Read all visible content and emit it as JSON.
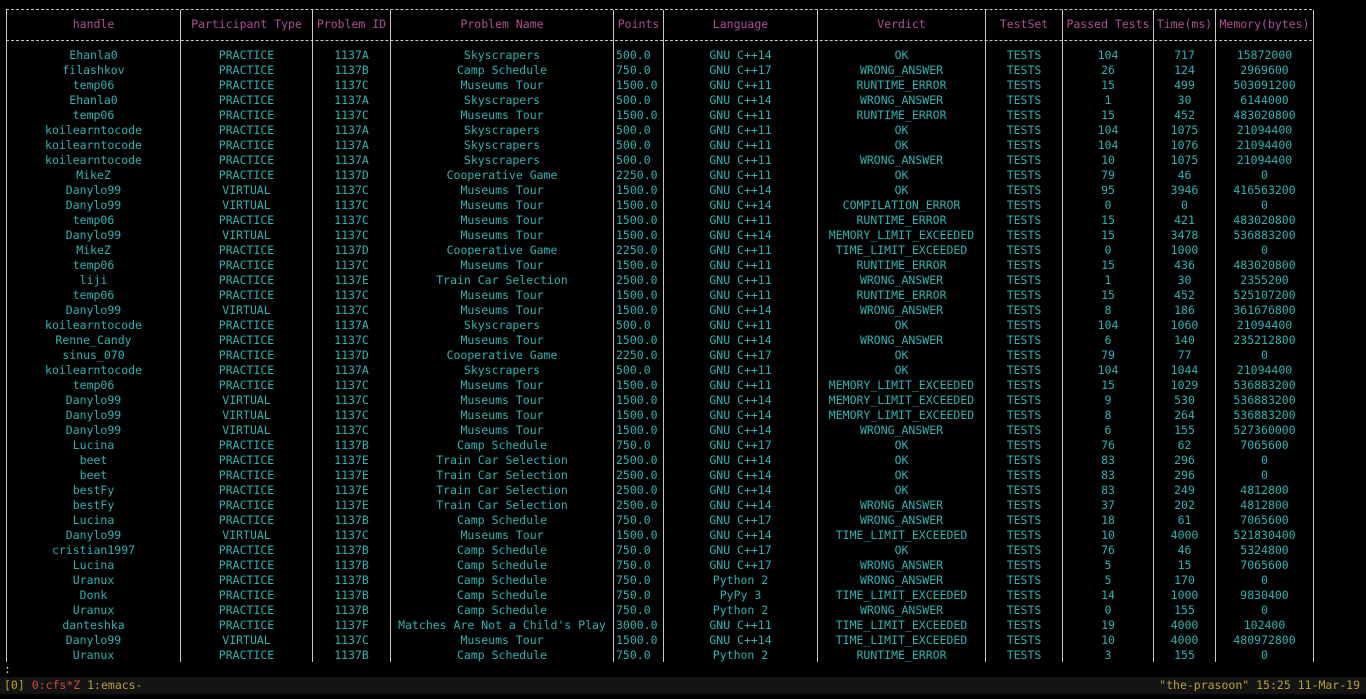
{
  "table": {
    "columns": [
      "handle",
      "Participant Type",
      "Problem ID",
      "Problem Name",
      "Points",
      "Language",
      "Verdict",
      "TestSet",
      "Passed Tests",
      "Time(ms)",
      "Memory(bytes)"
    ],
    "rows": [
      [
        "Ehanla0",
        "PRACTICE",
        "1137A",
        "Skyscrapers",
        "500.0",
        "GNU C++14",
        "OK",
        "TESTS",
        "104",
        "717",
        "15872000"
      ],
      [
        "filashkov",
        "PRACTICE",
        "1137B",
        "Camp Schedule",
        "750.0",
        "GNU C++17",
        "WRONG_ANSWER",
        "TESTS",
        "26",
        "124",
        "2969600"
      ],
      [
        "temp06",
        "PRACTICE",
        "1137C",
        "Museums Tour",
        "1500.0",
        "GNU C++11",
        "RUNTIME_ERROR",
        "TESTS",
        "15",
        "499",
        "503091200"
      ],
      [
        "Ehanla0",
        "PRACTICE",
        "1137A",
        "Skyscrapers",
        "500.0",
        "GNU C++14",
        "WRONG_ANSWER",
        "TESTS",
        "1",
        "30",
        "6144000"
      ],
      [
        "temp06",
        "PRACTICE",
        "1137C",
        "Museums Tour",
        "1500.0",
        "GNU C++11",
        "RUNTIME_ERROR",
        "TESTS",
        "15",
        "452",
        "483020800"
      ],
      [
        "koilearntocode",
        "PRACTICE",
        "1137A",
        "Skyscrapers",
        "500.0",
        "GNU C++11",
        "OK",
        "TESTS",
        "104",
        "1075",
        "21094400"
      ],
      [
        "koilearntocode",
        "PRACTICE",
        "1137A",
        "Skyscrapers",
        "500.0",
        "GNU C++11",
        "OK",
        "TESTS",
        "104",
        "1076",
        "21094400"
      ],
      [
        "koilearntocode",
        "PRACTICE",
        "1137A",
        "Skyscrapers",
        "500.0",
        "GNU C++11",
        "WRONG_ANSWER",
        "TESTS",
        "10",
        "1075",
        "21094400"
      ],
      [
        "MikeZ",
        "PRACTICE",
        "1137D",
        "Cooperative Game",
        "2250.0",
        "GNU C++11",
        "OK",
        "TESTS",
        "79",
        "46",
        "0"
      ],
      [
        "Danylo99",
        "VIRTUAL",
        "1137C",
        "Museums Tour",
        "1500.0",
        "GNU C++14",
        "OK",
        "TESTS",
        "95",
        "3946",
        "416563200"
      ],
      [
        "Danylo99",
        "VIRTUAL",
        "1137C",
        "Museums Tour",
        "1500.0",
        "GNU C++14",
        "COMPILATION_ERROR",
        "TESTS",
        "0",
        "0",
        "0"
      ],
      [
        "temp06",
        "PRACTICE",
        "1137C",
        "Museums Tour",
        "1500.0",
        "GNU C++11",
        "RUNTIME_ERROR",
        "TESTS",
        "15",
        "421",
        "483020800"
      ],
      [
        "Danylo99",
        "VIRTUAL",
        "1137C",
        "Museums Tour",
        "1500.0",
        "GNU C++14",
        "MEMORY_LIMIT_EXCEEDED",
        "TESTS",
        "15",
        "3478",
        "536883200"
      ],
      [
        "MikeZ",
        "PRACTICE",
        "1137D",
        "Cooperative Game",
        "2250.0",
        "GNU C++11",
        "TIME_LIMIT_EXCEEDED",
        "TESTS",
        "0",
        "1000",
        "0"
      ],
      [
        "temp06",
        "PRACTICE",
        "1137C",
        "Museums Tour",
        "1500.0",
        "GNU C++11",
        "RUNTIME_ERROR",
        "TESTS",
        "15",
        "436",
        "483020800"
      ],
      [
        "liji",
        "PRACTICE",
        "1137E",
        "Train Car Selection",
        "2500.0",
        "GNU C++11",
        "WRONG_ANSWER",
        "TESTS",
        "1",
        "30",
        "2355200"
      ],
      [
        "temp06",
        "PRACTICE",
        "1137C",
        "Museums Tour",
        "1500.0",
        "GNU C++11",
        "RUNTIME_ERROR",
        "TESTS",
        "15",
        "452",
        "525107200"
      ],
      [
        "Danylo99",
        "VIRTUAL",
        "1137C",
        "Museums Tour",
        "1500.0",
        "GNU C++14",
        "WRONG_ANSWER",
        "TESTS",
        "8",
        "186",
        "361676800"
      ],
      [
        "koilearntocode",
        "PRACTICE",
        "1137A",
        "Skyscrapers",
        "500.0",
        "GNU C++11",
        "OK",
        "TESTS",
        "104",
        "1060",
        "21094400"
      ],
      [
        "Renne_Candy",
        "PRACTICE",
        "1137C",
        "Museums Tour",
        "1500.0",
        "GNU C++14",
        "WRONG_ANSWER",
        "TESTS",
        "6",
        "140",
        "235212800"
      ],
      [
        "sinus_070",
        "PRACTICE",
        "1137D",
        "Cooperative Game",
        "2250.0",
        "GNU C++17",
        "OK",
        "TESTS",
        "79",
        "77",
        "0"
      ],
      [
        "koilearntocode",
        "PRACTICE",
        "1137A",
        "Skyscrapers",
        "500.0",
        "GNU C++11",
        "OK",
        "TESTS",
        "104",
        "1044",
        "21094400"
      ],
      [
        "temp06",
        "PRACTICE",
        "1137C",
        "Museums Tour",
        "1500.0",
        "GNU C++11",
        "MEMORY_LIMIT_EXCEEDED",
        "TESTS",
        "15",
        "1029",
        "536883200"
      ],
      [
        "Danylo99",
        "VIRTUAL",
        "1137C",
        "Museums Tour",
        "1500.0",
        "GNU C++14",
        "MEMORY_LIMIT_EXCEEDED",
        "TESTS",
        "9",
        "530",
        "536883200"
      ],
      [
        "Danylo99",
        "VIRTUAL",
        "1137C",
        "Museums Tour",
        "1500.0",
        "GNU C++14",
        "MEMORY_LIMIT_EXCEEDED",
        "TESTS",
        "8",
        "264",
        "536883200"
      ],
      [
        "Danylo99",
        "VIRTUAL",
        "1137C",
        "Museums Tour",
        "1500.0",
        "GNU C++14",
        "WRONG_ANSWER",
        "TESTS",
        "6",
        "155",
        "527360000"
      ],
      [
        "Lucina",
        "PRACTICE",
        "1137B",
        "Camp Schedule",
        "750.0",
        "GNU C++17",
        "OK",
        "TESTS",
        "76",
        "62",
        "7065600"
      ],
      [
        "beet",
        "PRACTICE",
        "1137E",
        "Train Car Selection",
        "2500.0",
        "GNU C++14",
        "OK",
        "TESTS",
        "83",
        "296",
        "0"
      ],
      [
        "beet",
        "PRACTICE",
        "1137E",
        "Train Car Selection",
        "2500.0",
        "GNU C++14",
        "OK",
        "TESTS",
        "83",
        "296",
        "0"
      ],
      [
        "bestFy",
        "PRACTICE",
        "1137E",
        "Train Car Selection",
        "2500.0",
        "GNU C++14",
        "OK",
        "TESTS",
        "83",
        "249",
        "4812800"
      ],
      [
        "bestFy",
        "PRACTICE",
        "1137E",
        "Train Car Selection",
        "2500.0",
        "GNU C++14",
        "WRONG_ANSWER",
        "TESTS",
        "37",
        "202",
        "4812800"
      ],
      [
        "Lucina",
        "PRACTICE",
        "1137B",
        "Camp Schedule",
        "750.0",
        "GNU C++17",
        "WRONG_ANSWER",
        "TESTS",
        "18",
        "61",
        "7065600"
      ],
      [
        "Danylo99",
        "VIRTUAL",
        "1137C",
        "Museums Tour",
        "1500.0",
        "GNU C++14",
        "TIME_LIMIT_EXCEEDED",
        "TESTS",
        "10",
        "4000",
        "521830400"
      ],
      [
        "cristian1997",
        "PRACTICE",
        "1137B",
        "Camp Schedule",
        "750.0",
        "GNU C++17",
        "OK",
        "TESTS",
        "76",
        "46",
        "5324800"
      ],
      [
        "Lucina",
        "PRACTICE",
        "1137B",
        "Camp Schedule",
        "750.0",
        "GNU C++17",
        "WRONG_ANSWER",
        "TESTS",
        "5",
        "15",
        "7065600"
      ],
      [
        "Uranux",
        "PRACTICE",
        "1137B",
        "Camp Schedule",
        "750.0",
        "Python 2",
        "WRONG_ANSWER",
        "TESTS",
        "5",
        "170",
        "0"
      ],
      [
        "Donk",
        "PRACTICE",
        "1137B",
        "Camp Schedule",
        "750.0",
        "PyPy 3",
        "TIME_LIMIT_EXCEEDED",
        "TESTS",
        "14",
        "1000",
        "9830400"
      ],
      [
        "Uranux",
        "PRACTICE",
        "1137B",
        "Camp Schedule",
        "750.0",
        "Python 2",
        "WRONG_ANSWER",
        "TESTS",
        "0",
        "155",
        "0"
      ],
      [
        "danteshka",
        "PRACTICE",
        "1137F",
        "Matches Are Not a Child's Play",
        "3000.0",
        "GNU C++11",
        "TIME_LIMIT_EXCEEDED",
        "TESTS",
        "19",
        "4000",
        "102400"
      ],
      [
        "Danylo99",
        "VIRTUAL",
        "1137C",
        "Museums Tour",
        "1500.0",
        "GNU C++14",
        "TIME_LIMIT_EXCEEDED",
        "TESTS",
        "10",
        "4000",
        "480972800"
      ],
      [
        "Uranux",
        "PRACTICE",
        "1137B",
        "Camp Schedule",
        "750.0",
        "Python 2",
        "RUNTIME_ERROR",
        "TESTS",
        "3",
        "155",
        "0"
      ]
    ]
  },
  "prompt": ":",
  "statusbar": {
    "session": "[0]",
    "window_active": "0:cfs*Z",
    "window_other": "1:emacs-",
    "hostname": "\"the-prasoon\"",
    "time": "15:25",
    "date": "11-Mar-19"
  },
  "colors": {
    "background": "#000000",
    "text": "#2bb3b3",
    "header": "#b04d95",
    "border": "#c8c8c8",
    "status_text": "#b8a030",
    "status_active": "#d24a3a",
    "status_bg": "#141414"
  }
}
